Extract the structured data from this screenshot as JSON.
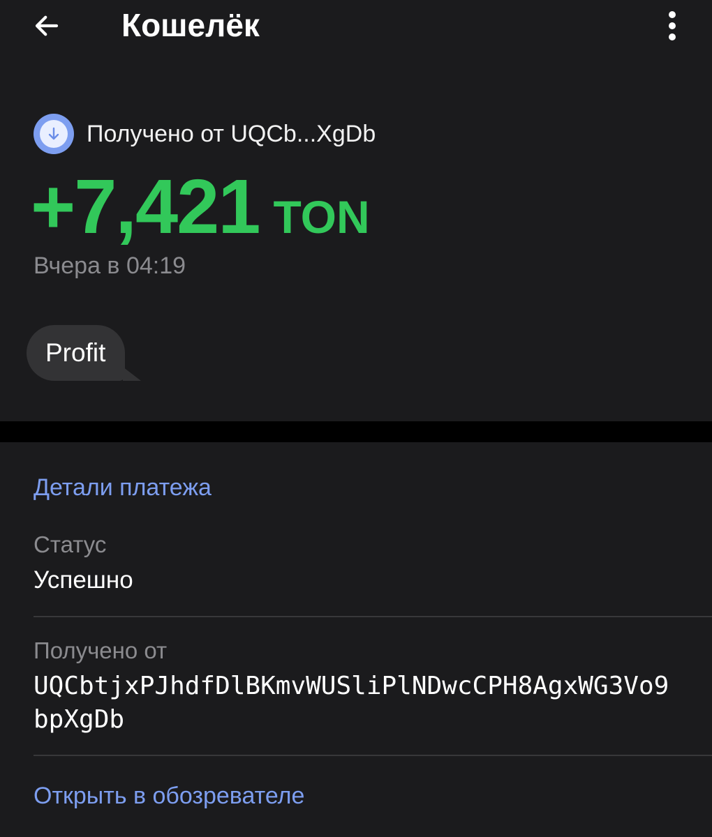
{
  "header": {
    "title": "Кошелёк",
    "back_icon": "arrow-left-icon",
    "menu_icon": "more-vertical-icon"
  },
  "transaction": {
    "direction_icon": "arrow-down-icon",
    "direction_text": "Получено от UQCb...XgDb",
    "amount": "+7,421",
    "currency": "TON",
    "datetime": "Вчера в 04:19",
    "comment": "Profit",
    "amount_color": "#32c85a"
  },
  "details": {
    "title": "Детали платежа",
    "status_label": "Статус",
    "status_value": "Успешно",
    "from_label": "Получено от",
    "from_address": "UQCbtjxPJhdfDlBKmvWUSliPlNDwcCPH8AgxWG3Vo9bpXgDb",
    "open_link": "Открыть в обозревателе"
  },
  "colors": {
    "background": "#1b1b1d",
    "accent": "#7d9ef0",
    "positive": "#32c85a",
    "secondary_text": "#8b8b8f"
  }
}
